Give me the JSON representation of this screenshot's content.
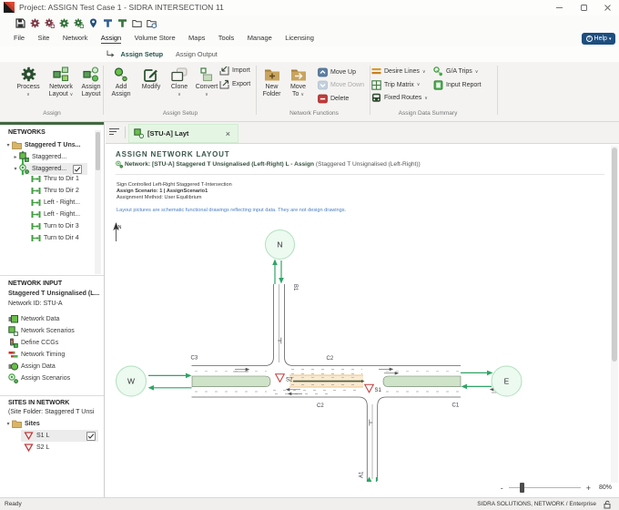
{
  "window": {
    "title": "Project: ASSIGN Test Case 1  -  SIDRA INTERSECTION 11",
    "controls": {
      "minimize": "minimize",
      "maximize": "maximize",
      "close": "close"
    }
  },
  "quick_access_icons": [
    "save",
    "process-site",
    "process-site-scenarios",
    "process-network",
    "process-network-scenarios",
    "map-pin",
    "site-layout",
    "network-layout",
    "open-project",
    "open-recent"
  ],
  "menu": {
    "items": [
      "File",
      "Site",
      "Network",
      "Assign",
      "Volume Store",
      "Maps",
      "Tools",
      "Manage",
      "Licensing"
    ],
    "active": "Assign",
    "help": "Help"
  },
  "subtabs": {
    "items": [
      "Assign Setup",
      "Assign Output"
    ],
    "active": "Assign Setup"
  },
  "ribbon": {
    "groups": [
      {
        "label": "Assign",
        "buttons": [
          {
            "label": "Process",
            "dropdown": true
          },
          {
            "label": "Network Layout",
            "dropdown": true
          },
          {
            "label": "Assign Layout",
            "dropdown": false
          }
        ]
      },
      {
        "label": "Assign Setup",
        "buttons": [
          {
            "label": "Add Assign",
            "dropdown": false
          },
          {
            "label": "Modify",
            "dropdown": false
          },
          {
            "label": "Clone",
            "dropdown": true
          },
          {
            "label": "Convert",
            "dropdown": true
          },
          {
            "label": "Import",
            "dropdown": false
          },
          {
            "label": "Export",
            "dropdown": false
          }
        ]
      },
      {
        "label": "Network Functions",
        "buttons": [
          {
            "label": "New Folder",
            "dropdown": false
          },
          {
            "label": "Move To",
            "dropdown": true
          },
          {
            "label": "Move Up",
            "dropdown": false
          },
          {
            "label": "Move Down",
            "dropdown": false,
            "disabled": true
          },
          {
            "label": "Delete",
            "dropdown": false
          }
        ]
      },
      {
        "label": "Assign Data Summary",
        "buttons": [
          {
            "label": "Desire Lines",
            "dropdown": true
          },
          {
            "label": "Trip Matrix",
            "dropdown": true
          },
          {
            "label": "Fixed Routes",
            "dropdown": true
          },
          {
            "label": "G/A Trips",
            "dropdown": true
          },
          {
            "label": "Input Report",
            "dropdown": false
          }
        ]
      }
    ]
  },
  "networks_panel": {
    "title": "NETWORKS",
    "folder": "Staggered T Uns...",
    "networks": [
      {
        "label": "Staggered...",
        "checked": false
      },
      {
        "label": "Staggered...",
        "checked": true
      }
    ],
    "routes": [
      "Thru to Dir 1",
      "Thru to Dir 2",
      "Left - Right...",
      "Left - Right...",
      "Turn to Dir 3",
      "Turn to Dir 4"
    ]
  },
  "network_input_panel": {
    "title": "NETWORK INPUT",
    "subtitle": "Staggered T Unsignalised (L...",
    "network_id": "Network ID: STU-A",
    "items": [
      "Network Data",
      "Network Scenarios",
      "Define CCGs",
      "Network Timing",
      "Assign Data",
      "Assign Scenarios"
    ]
  },
  "sites_panel": {
    "title": "SITES IN NETWORK",
    "subtitle": "(Site Folder: Staggered T Unsi",
    "folder": "Sites",
    "sites": [
      {
        "label": "S1 L",
        "checked": true
      },
      {
        "label": "S2 L",
        "checked": false
      }
    ]
  },
  "document": {
    "tab_label": "[STU-A] Layt",
    "close": "×",
    "heading": "ASSIGN NETWORK LAYOUT",
    "network_bold": "Network: [STU-A] Staggered T Unsignalised (Left-Right) L - Assign",
    "network_rest": " (Staggered T Unsignalised (Left-Right))",
    "info_line1": "Sign Controlled Left-Right Staggered T-Intersection",
    "info_line2": "Assign Scenario: 1 | AssignScenario1",
    "info_line3": "Assignment Method: User Equilibrium",
    "note": "Layout pictures are schematic functional drawings reflecting input data. They are not design drawings."
  },
  "diagram": {
    "north": "N",
    "node_n": "N",
    "node_w": "W",
    "node_e": "E",
    "label_b1": "B1",
    "label_a1": "A1",
    "label_c1": "C1",
    "label_c2_top": "C2",
    "label_c2_bottom": "C2",
    "label_c3": "C3",
    "site_s1": "S1",
    "site_s2": "S2"
  },
  "zoom": {
    "minus": "-",
    "plus": "+",
    "value": "80%"
  },
  "statusbar": {
    "left": "Ready",
    "right": "SIDRA SOLUTIONS, NETWORK / Enterprise"
  }
}
